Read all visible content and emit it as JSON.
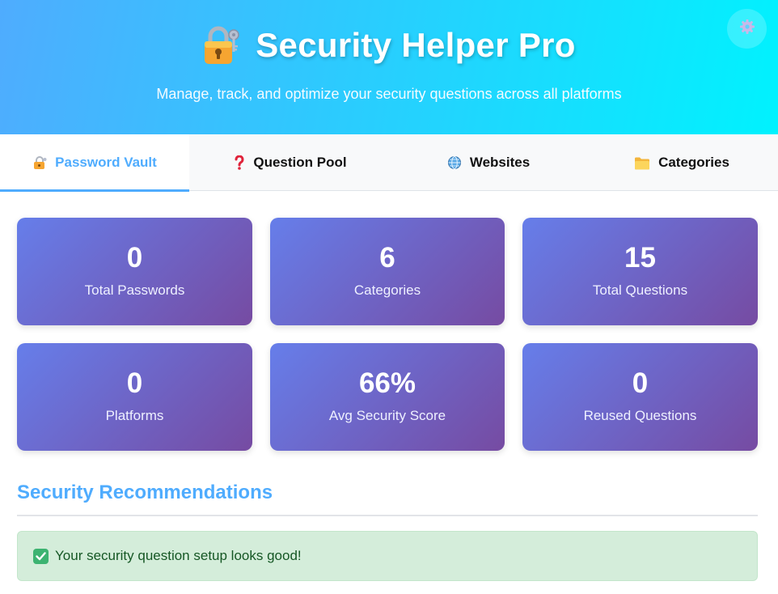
{
  "header": {
    "title": "Security Helper Pro",
    "subtitle": "Manage, track, and optimize your security questions across all platforms",
    "icon": "lock-with-key-icon",
    "settings_icon": "gear-icon"
  },
  "tabs": [
    {
      "label": "Password Vault",
      "icon": "lock-icon",
      "active": true
    },
    {
      "label": "Question Pool",
      "icon": "question-mark-icon",
      "active": false
    },
    {
      "label": "Websites",
      "icon": "globe-icon",
      "active": false
    },
    {
      "label": "Categories",
      "icon": "folder-icon",
      "active": false
    }
  ],
  "stats": [
    {
      "value": "0",
      "label": "Total Passwords"
    },
    {
      "value": "6",
      "label": "Categories"
    },
    {
      "value": "15",
      "label": "Total Questions"
    },
    {
      "value": "0",
      "label": "Platforms"
    },
    {
      "value": "66%",
      "label": "Avg Security Score"
    },
    {
      "value": "0",
      "label": "Reused Questions"
    }
  ],
  "recommendations": {
    "title": "Security Recommendations",
    "message": "Your security question setup looks good!",
    "message_icon": "check-mark-icon"
  },
  "colors": {
    "header_gradient_start": "#4facfe",
    "header_gradient_end": "#00f2fe",
    "card_gradient_start": "#667eea",
    "card_gradient_end": "#764ba2",
    "accent": "#4facfe",
    "success_bg": "#d4edda",
    "success_text": "#155724"
  }
}
